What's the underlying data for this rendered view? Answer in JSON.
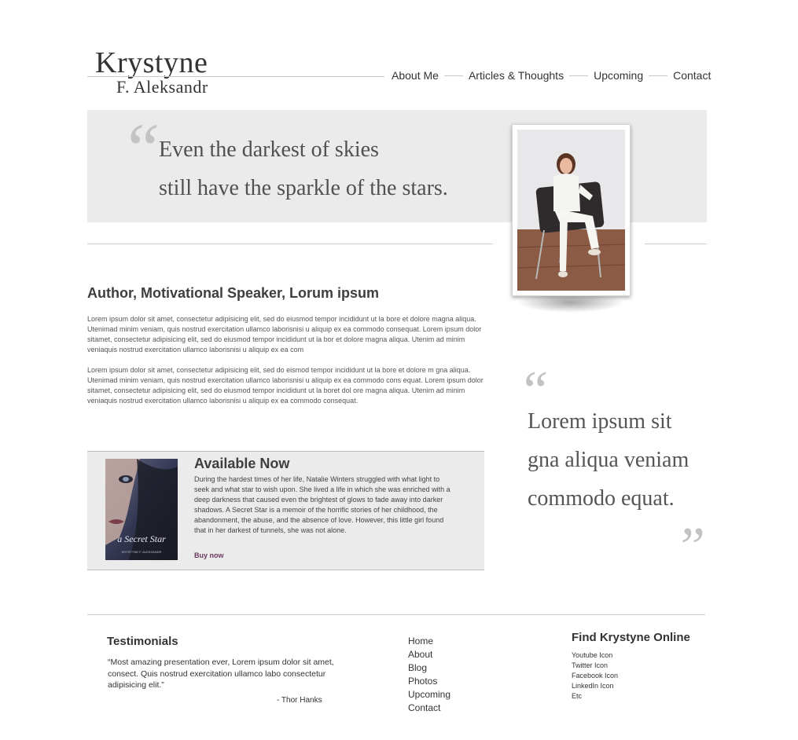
{
  "brand": {
    "first_name": "Krystyne",
    "last_name": "F. Aleksandr"
  },
  "nav": {
    "items": [
      "About Me",
      "Articles & Thoughts",
      "Upcoming",
      "Contact"
    ]
  },
  "hero": {
    "open_quote": "“",
    "quote_line1": "Even the darkest of skies",
    "quote_line2": "still have the sparkle of the stars."
  },
  "intro": {
    "heading": "Author, Motivational Speaker, Lorum ipsum",
    "paragraph1": "Lorem ipsum dolor sit amet, consectetur adipisicing elit, sed do eiusmod tempor incididunt ut la bore et dolore magna aliqua. Utenimad minim veniam, quis nostrud exercitation ullamco laborisnisi u aliquip ex ea commodo consequat.  Lorem ipsum dolor sitamet, consectetur adipisicing elit, sed do eiusmod tempor incididunt ut la bor et dolore magna aliqua. Utenim ad minim veniaquis nostrud exercitation ullamco laborisnisi u aliquip ex ea com",
    "paragraph2": "Lorem ipsum dolor sit amet, consectetur adipisicing elit, sed do eismod tempor incididunt ut la bore et dolore m gna aliqua. Utenimad minim veniam, quis nostrud exercitation ullamco laborisnisi u aliquip ex ea commodo cons equat.  Lorem ipsum dolor sitamet, consectetur adipisicing elit, sed do eiusmod tempor incididunt ut la boret dol ore magna aliqua. Utenim ad minim veniaquis nostrud exercitation ullamco laborisnisi u aliquip ex ea commodo consequat."
  },
  "side_quote": {
    "open_quote": "“",
    "line1": "Lorem ipsum sit",
    "line2": "gna aliqua veniam",
    "line3": "commodo equat.",
    "close_quote": "”"
  },
  "book": {
    "cover_title": "a Secret Star",
    "cover_author": "KRYSTYNE F. ALEKSANDR",
    "heading": "Available Now",
    "description": "During the hardest times of her life, Natalie Winters struggled with what light to seek and what star to wish upon. She lived a life in which she was enriched with a deep darkness that caused even the brightest of glows to fade away into darker shadows. A Secret Star is a memoir of the horrific stories of her childhood, the abandonment, the abuse, and the absence of love. However, this little girl found that in her darkest of tunnels, she was not alone.",
    "buy_label": "Buy now"
  },
  "testimonials": {
    "heading": "Testimonials",
    "quote": "“Most amazing presentation ever, Lorem ipsum dolor sit amet, consect. Quis nostrud exercitation ullamco labo consectetur adipisicing elit.”",
    "author": "- Thor Hanks"
  },
  "footer_nav": {
    "items": [
      "Home",
      "About",
      "Blog",
      "Photos",
      "Upcoming",
      "Contact"
    ]
  },
  "find_online": {
    "heading": "Find Krystyne Online",
    "items": [
      "Youtube Icon",
      "Twitter Icon",
      "Facebook Icon",
      "LinkedIn Icon",
      "Etc"
    ]
  }
}
